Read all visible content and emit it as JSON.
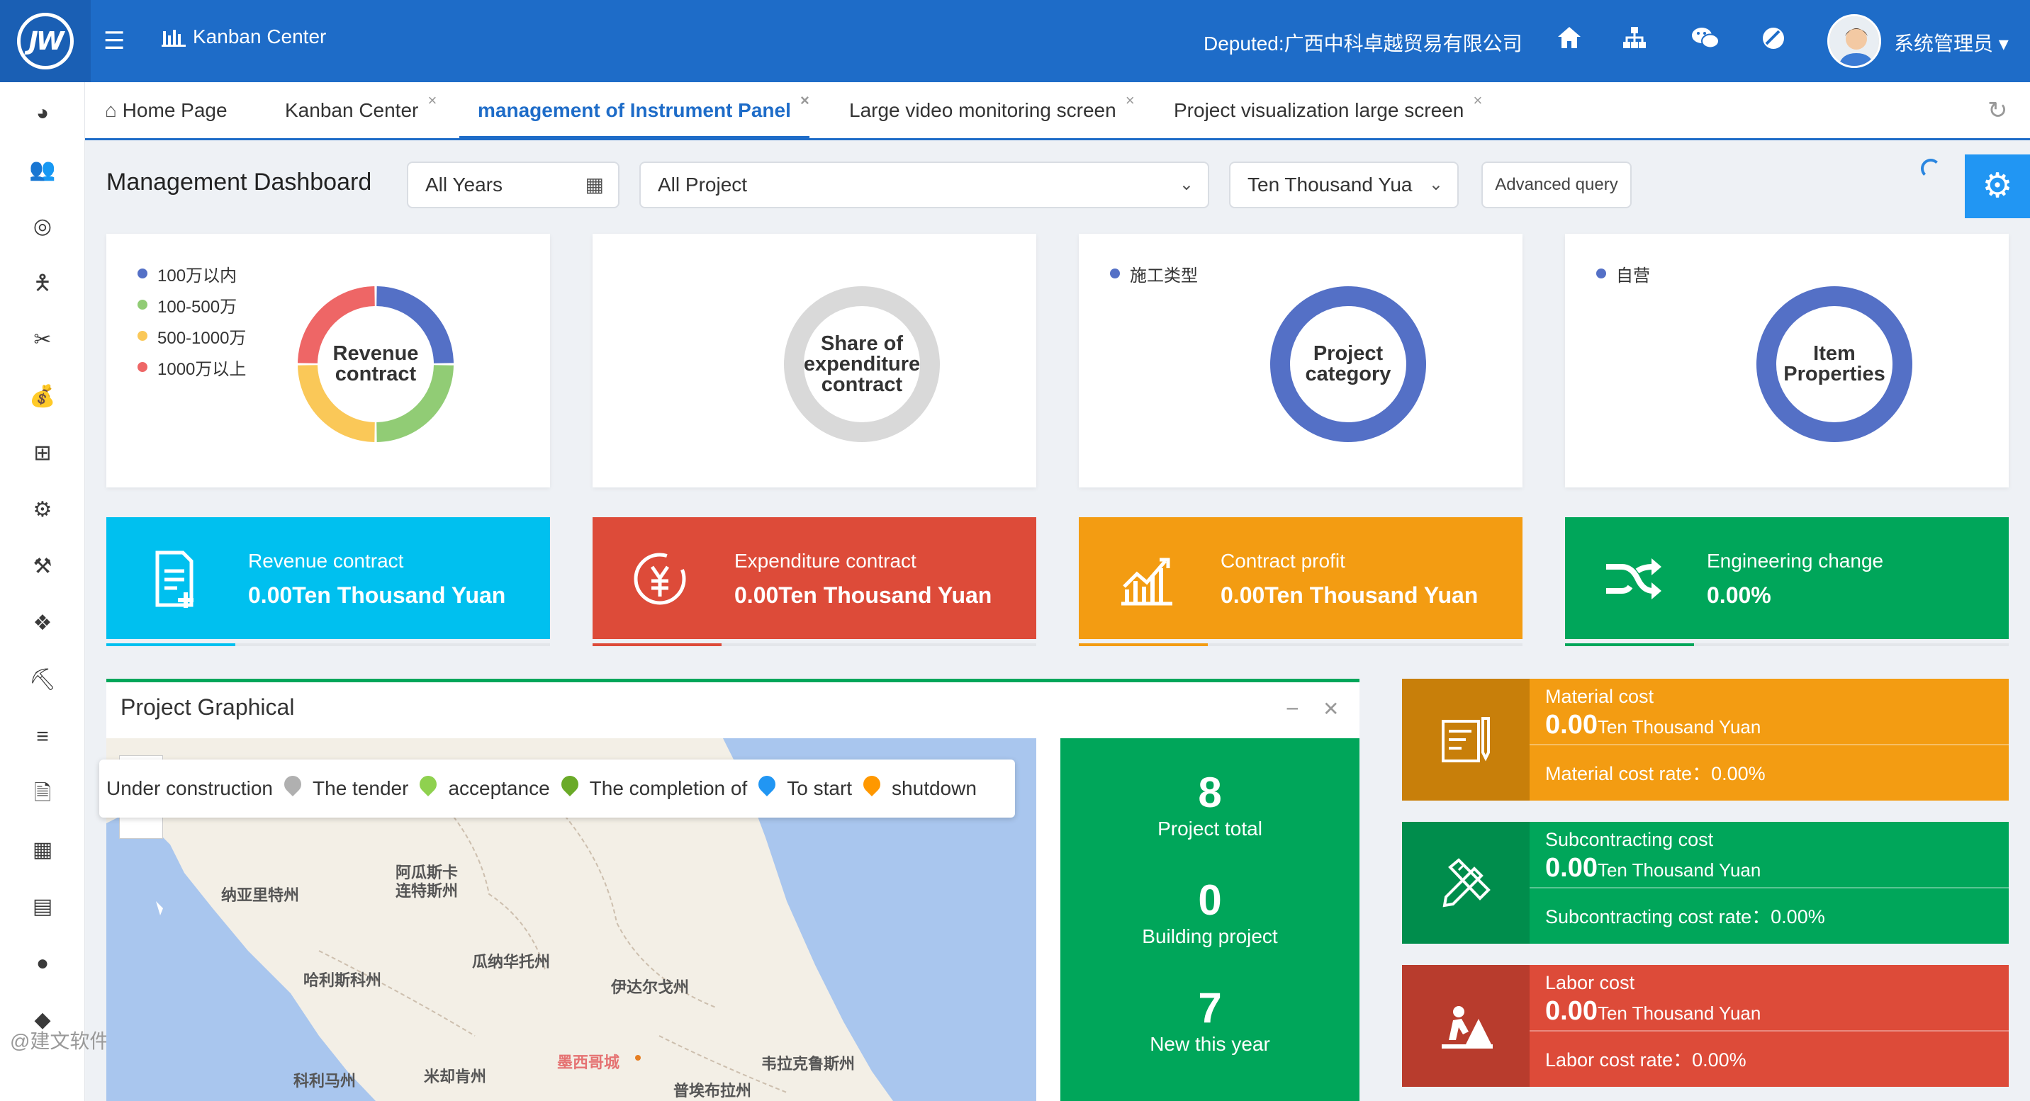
{
  "header": {
    "logo_text": "JW",
    "app_title": "Kanban Center",
    "deputed": "Deputed:广西中科卓越贸易有限公司",
    "username": "系统管理员"
  },
  "tabs": [
    {
      "label": "Home Page",
      "closable": false
    },
    {
      "label": "Kanban Center",
      "closable": true
    },
    {
      "label": "management of Instrument Panel",
      "closable": true,
      "active": true
    },
    {
      "label": "Large video monitoring screen",
      "closable": true
    },
    {
      "label": "Project visualization large screen",
      "closable": true
    }
  ],
  "filters": {
    "page_title": "Management Dashboard",
    "year": "All Years",
    "project": "All Project",
    "unit": "Ten Thousand Yua",
    "advanced": "Advanced query"
  },
  "donuts": [
    {
      "label_lines": [
        "Revenue",
        "contract"
      ],
      "legend": [
        "100万以内",
        "100-500万",
        "500-1000万",
        "1000万以上"
      ],
      "colors": [
        "#5470c6",
        "#91cc75",
        "#fac858",
        "#ee6666"
      ]
    },
    {
      "label_lines": [
        "Share of",
        "expenditure",
        "contract"
      ],
      "legend": [],
      "colors": [
        "#d9d9d9"
      ]
    },
    {
      "label_lines": [
        "Project",
        "category"
      ],
      "legend": [
        "施工类型"
      ],
      "colors": [
        "#5470c6"
      ]
    },
    {
      "label_lines": [
        "Item",
        "Properties"
      ],
      "legend": [
        "自营"
      ],
      "colors": [
        "#5470c6"
      ]
    }
  ],
  "kpis": [
    {
      "label": "Revenue contract",
      "value": "0.00Ten Thousand Yuan",
      "color": "#00c0ef",
      "progress": 0.29
    },
    {
      "label": "Expenditure contract",
      "value": "0.00Ten Thousand Yuan",
      "color": "#dd4b39",
      "progress": 0.29
    },
    {
      "label": "Contract profit",
      "value": "0.00Ten Thousand Yuan",
      "color": "#f39c12",
      "progress": 0.29
    },
    {
      "label": "Engineering change",
      "value": "0.00%",
      "color": "#00a65a",
      "progress": 0.29
    }
  ],
  "project_panel": {
    "title": "Project Graphical",
    "legend": [
      {
        "label": "Under construction",
        "color": null
      },
      {
        "label": "The tender",
        "color": "#b0b0b0"
      },
      {
        "label": "acceptance",
        "color": "#8fd14f"
      },
      {
        "label": "The completion of",
        "color": "#6aaa28"
      },
      {
        "label": "To start",
        "color": "#2196f3"
      },
      {
        "label": "shutdown",
        "color": "#ff9800"
      }
    ],
    "map_labels": [
      "阿瓜斯卡",
      "连特斯州",
      "纳亚里特州",
      "瓜纳华托州",
      "哈利斯科州",
      "伊达尔戈州",
      "墨西哥城",
      "韦拉克鲁斯州",
      "科利马州",
      "米却肯州",
      "普埃布拉州"
    ],
    "stats": [
      {
        "value": "8",
        "label": "Project total"
      },
      {
        "value": "0",
        "label": "Building project"
      },
      {
        "value": "7",
        "label": "New this year"
      }
    ]
  },
  "costs": [
    {
      "title": "Material cost",
      "value": "0.00",
      "unit": "Ten Thousand Yuan",
      "rate": "Material cost rate：0.00%",
      "color": "#f39c12",
      "side_color": "#c87f0a"
    },
    {
      "title": "Subcontracting cost",
      "value": "0.00",
      "unit": "Ten Thousand Yuan",
      "rate": "Subcontracting cost rate：0.00%",
      "color": "#00a65a",
      "side_color": "#008d4c"
    },
    {
      "title": "Labor cost",
      "value": "0.00",
      "unit": "Ten Thousand Yuan",
      "rate": "Labor cost rate：0.00%",
      "color": "#dd4b39",
      "side_color": "#b83c2d"
    }
  ],
  "watermark": "@建文软件"
}
